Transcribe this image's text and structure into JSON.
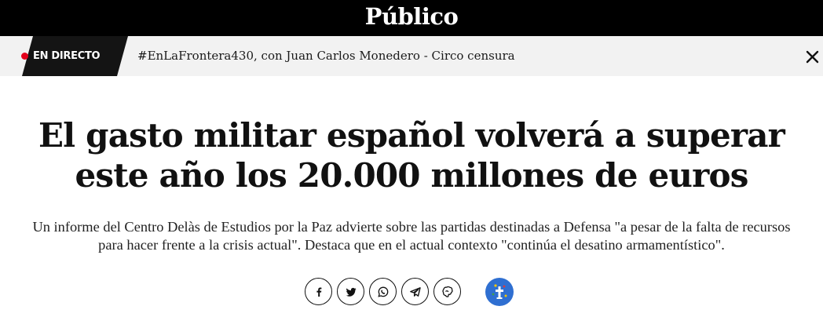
{
  "header": {
    "logo": "Público"
  },
  "live": {
    "label": "EN DIRECTO",
    "text": "#EnLaFrontera430, con Juan Carlos Monedero - Circo censura",
    "close_icon": "close-icon"
  },
  "article": {
    "headline": "El gasto militar español volverá a superar este año los 20.000 millones de euros",
    "summary": "Un informe del Centro Delàs de Estudios por la Paz advierte sobre las partidas destinadas a Defensa \"a pesar de la falta de recursos para hacer frente a la crisis actual\". Destaca que en el actual contexto \"continúa el desatino armamentístico\"."
  },
  "share": {
    "icons": [
      "facebook-icon",
      "twitter-icon",
      "whatsapp-icon",
      "telegram-icon",
      "meneame-icon"
    ],
    "badge_icon": "accessibility-badge-icon"
  },
  "colors": {
    "topbar": "#000000",
    "livebar": "#f2f2f2",
    "live_tag": "#141414",
    "live_dot": "#e3001b",
    "badge": "#2f6fd1"
  }
}
